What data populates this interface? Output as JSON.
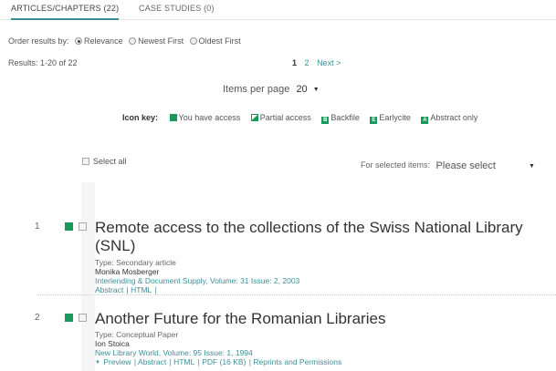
{
  "tabs": [
    {
      "label": "ARTICLES/CHAPTERS (22)",
      "active": true
    },
    {
      "label": "CASE STUDIES (0)",
      "active": false
    }
  ],
  "order": {
    "label": "Order results by:",
    "options": [
      "Relevance",
      "Newest First",
      "Oldest First"
    ],
    "selected": "Relevance"
  },
  "results_summary": "Results: 1-20 of 22",
  "pager": {
    "current": "1",
    "next_page": "2",
    "next_label": "Next >"
  },
  "items_per_page": {
    "label": "Items per page",
    "value": "20"
  },
  "icon_key": {
    "label": "Icon key:",
    "items": [
      {
        "glyph": "",
        "label": "You have access",
        "icon": "access-icon"
      },
      {
        "glyph": "",
        "label": "Partial access",
        "icon": "partial-access-icon"
      },
      {
        "glyph": "B",
        "label": "Backfile",
        "icon": "backfile-icon"
      },
      {
        "glyph": "E",
        "label": "Earlycite",
        "icon": "earlycite-icon"
      },
      {
        "glyph": "A",
        "label": "Abstract only",
        "icon": "abstract-only-icon"
      }
    ]
  },
  "bulk": {
    "select_all": "Select all",
    "for_selected": "For selected items:",
    "action_value": "Please select"
  },
  "results": [
    {
      "number": "1",
      "title": "Remote access to the collections of the Swiss National Library (SNL)",
      "type": "Type: Secondary article",
      "author": "Monika Mosberger",
      "journal": "Interlending & Document Supply, Volume: 31 Issue: 2, 2003",
      "links": [
        "Abstract",
        "HTML"
      ]
    },
    {
      "number": "2",
      "title": "Another Future for the Romanian Libraries",
      "type": "Type: Conceptual Paper",
      "author": "Ion Stoica",
      "journal": "New Library World, Volume: 95 Issue: 1, 1994",
      "links": [
        "Preview",
        "Abstract",
        "HTML",
        "PDF (16 KB)",
        "Reprints and Permissions"
      ]
    }
  ],
  "colors": {
    "accent": "#3c8f9a",
    "access": "#1a9a5a"
  }
}
